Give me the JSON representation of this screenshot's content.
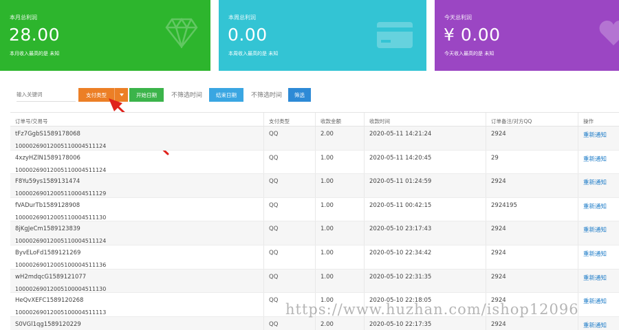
{
  "cards": [
    {
      "title": "本月总利润",
      "value": "28.00",
      "sub": "本月收入最高的是 未知",
      "color": "#2db52d",
      "icon": "diamond-icon"
    },
    {
      "title": "本周总利润",
      "value": "0.00",
      "sub": "本周收入最高的是 未知",
      "color": "#33c4d4",
      "icon": "credit-card-icon"
    },
    {
      "title": "今天总利润",
      "value": "¥ 0.00",
      "sub": "今天收入最高的是 未知",
      "color": "#9b46c3",
      "icon": "heart-icon"
    }
  ],
  "filter": {
    "keyword_placeholder": "输入关键词",
    "pay_type_label": "支付类型",
    "start_date_label": "开始日期",
    "no_start_text": "不筛选时间",
    "end_date_label": "结束日期",
    "no_end_text": "不筛选时间",
    "filter_label": "筛选"
  },
  "table": {
    "headers": [
      "订单号/交易号",
      "支付类型",
      "收款金额",
      "收款时间",
      "订单备注/对方QQ",
      "操作"
    ],
    "rows": [
      {
        "order": "tFz7GgbS1589178068",
        "trade": "10000269012005110004511124",
        "type": "QQ",
        "amount": "2.00",
        "time": "2020-05-11 14:21:24",
        "remark": "2924",
        "action": "重新通知"
      },
      {
        "order": "4xzyHZlN1589178006",
        "trade": "10000269012005110004511124",
        "type": "QQ",
        "amount": "1.00",
        "time": "2020-05-11 14:20:45",
        "remark": "29",
        "action": "重新通知"
      },
      {
        "order": "F8Yu59ys1589131474",
        "trade": "10000269012005110004511129",
        "type": "QQ",
        "amount": "1.00",
        "time": "2020-05-11 01:24:59",
        "remark": "2924",
        "action": "重新通知"
      },
      {
        "order": "fVADurTb1589128908",
        "trade": "10000269012005110004511130",
        "type": "QQ",
        "amount": "1.00",
        "time": "2020-05-11 00:42:15",
        "remark": "2924195",
        "action": "重新通知"
      },
      {
        "order": "8jKgJeCm1589123839",
        "trade": "10000269012005110004511124",
        "type": "QQ",
        "amount": "1.00",
        "time": "2020-05-10 23:17:43",
        "remark": "2924",
        "action": "重新通知"
      },
      {
        "order": "ByvELoFd1589121269",
        "trade": "10000269012005100004511136",
        "type": "QQ",
        "amount": "1.00",
        "time": "2020-05-10 22:34:42",
        "remark": "2924",
        "action": "重新通知"
      },
      {
        "order": "wH2mdqcG1589121077",
        "trade": "10000269012005100004511130",
        "type": "QQ",
        "amount": "1.00",
        "time": "2020-05-10 22:31:35",
        "remark": "2924",
        "action": "重新通知"
      },
      {
        "order": "HeQvXEFC1589120268",
        "trade": "10000269012005100004511113",
        "type": "QQ",
        "amount": "1.00",
        "time": "2020-05-10 22:18:05",
        "remark": "2924",
        "action": "重新通知"
      },
      {
        "order": "S0VGl1qg1589120229",
        "trade": "",
        "type": "QQ",
        "amount": "2.00",
        "time": "2020-05-10 22:17:35",
        "remark": "2924",
        "action": "重新通知"
      }
    ]
  },
  "watermark": "https://www.huzhan.com/ishop12096"
}
